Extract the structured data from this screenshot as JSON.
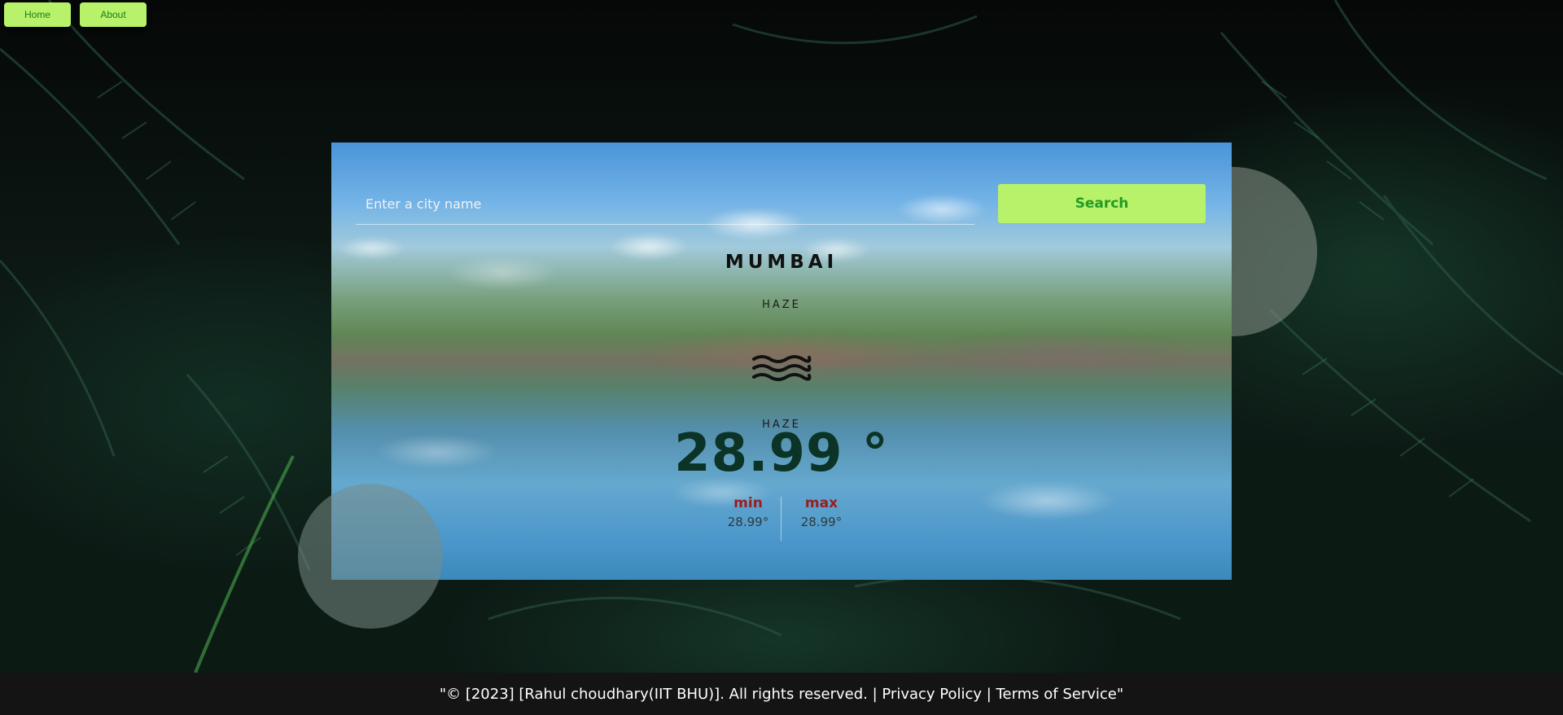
{
  "nav": {
    "home_label": "Home",
    "about_label": "About"
  },
  "search": {
    "placeholder": "Enter a city name",
    "button_label": "Search"
  },
  "weather": {
    "city": "MUMBAI",
    "condition": "HAZE",
    "condition_icon": "haze-icon",
    "temperature": "28.99 °",
    "min_label": "min",
    "min_value": "28.99°",
    "max_label": "max",
    "max_value": "28.99°"
  },
  "footer": {
    "text": "\"© [2023] [Rahul choudhary(IIT BHU)]. All rights reserved. | Privacy Policy | Terms of Service\""
  },
  "colors": {
    "accent": "#b7f26a",
    "accent_text": "#249a24",
    "temp_text": "#0b3326",
    "minmax_label": "#9b1c1c",
    "footer_bg": "#141414"
  }
}
